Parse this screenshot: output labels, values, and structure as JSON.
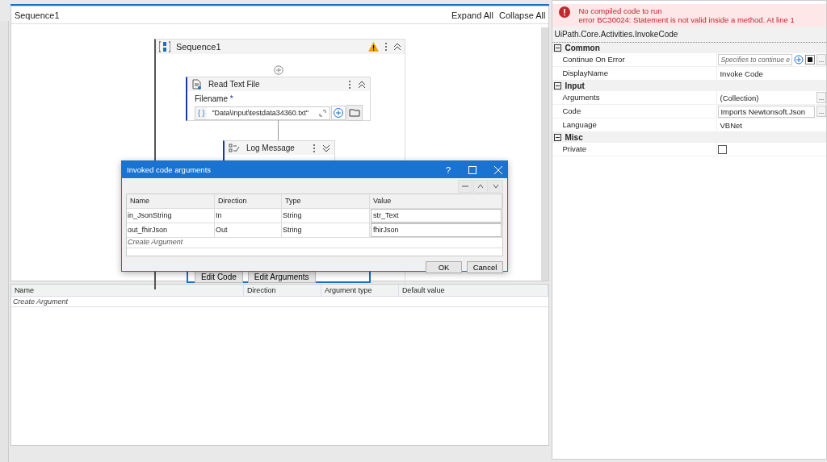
{
  "designer": {
    "breadcrumb": "Sequence1",
    "expand_all": "Expand All",
    "collapse_all": "Collapse All"
  },
  "sequence": {
    "title": "Sequence1",
    "warning": true
  },
  "read_text_file": {
    "title": "Read Text File",
    "field_label": "Filename",
    "required_mark": "*",
    "expression_mark": "{ }",
    "value": "\"Data\\Input\\testdata34360.txt\""
  },
  "log_message": {
    "title": "Log Message"
  },
  "invoke_code": {
    "buttons": [
      "Edit Code",
      "Edit Arguments"
    ]
  },
  "arguments_panel": {
    "columns": [
      "Name",
      "Direction",
      "Argument type",
      "Default value"
    ],
    "create": "Create Argument"
  },
  "properties": {
    "error": [
      "No compiled code to run",
      "error BC30024: Statement is not valid inside a method. At line 1"
    ],
    "type_name": "UiPath.Core.Activities.InvokeCode",
    "categories": [
      {
        "name": "Common",
        "expanded": true,
        "rows": [
          {
            "name": "Continue On Error",
            "kind": "expression",
            "placeholder": "Specifies to continue e",
            "button": "..."
          },
          {
            "name": "DisplayName",
            "kind": "text",
            "value": "Invoke Code"
          }
        ]
      },
      {
        "name": "Input",
        "expanded": true,
        "rows": [
          {
            "name": "Arguments",
            "kind": "collection",
            "value": "(Collection)",
            "button": "..."
          },
          {
            "name": "Code",
            "kind": "field",
            "value": "Imports Newtonsoft.Json",
            "button": "..."
          },
          {
            "name": "Language",
            "kind": "text",
            "value": "VBNet"
          }
        ]
      },
      {
        "name": "Misc",
        "expanded": true,
        "rows": [
          {
            "name": "Private",
            "kind": "checkbox",
            "checked": false
          }
        ]
      }
    ]
  },
  "dialog": {
    "title": "Invoked code arguments",
    "help": "?",
    "columns": [
      "Name",
      "Direction",
      "Type",
      "Value"
    ],
    "rows": [
      {
        "name": "in_JsonString",
        "direction": "In",
        "type": "String",
        "value": "str_Text"
      },
      {
        "name": "out_fhirJson",
        "direction": "Out",
        "type": "String",
        "value": "fhirJson"
      }
    ],
    "create": "Create Argument",
    "buttons": [
      "OK",
      "Cancel"
    ]
  }
}
